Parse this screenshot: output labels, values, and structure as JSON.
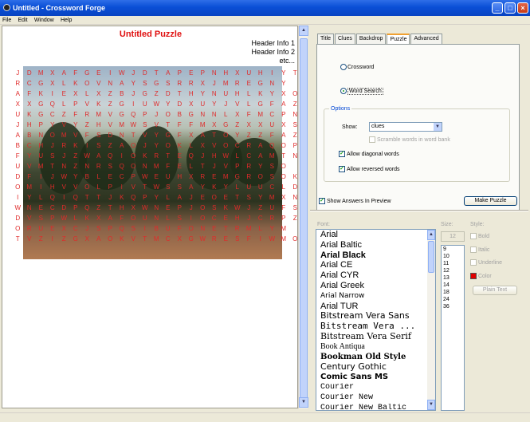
{
  "window": {
    "title": "Untitled - Crossword Forge"
  },
  "menu": [
    "File",
    "Edit",
    "Window",
    "Help"
  ],
  "puzzle": {
    "title": "Untitled Puzzle",
    "header_lines": [
      "Header Info 1",
      "Header Info 2",
      "etc..."
    ],
    "grid": [
      "JDMXAFGEIWJDTAPEPNHXUHIYT",
      "RCGXLKOVNAYSGSRRXJMREGNY",
      "AFKIEXLXZBJGZDTHYNUHLKYXO",
      "XXGQLPVKZGIUWYDXUYJVLGFAZ",
      "UKGCZFRMVGQPJOBGNNLXFMCPN",
      "JHPYVYZHVMWSVTFFMXGZXXUXS",
      "ABNOMVFSDNTVYGFXATOYZZFAZ",
      "BCHJRKISZAOJYOKLXVOCRAQOPN",
      "FYUSJZWAQIOKRTEQJHWLCAMTN",
      "UVMTNZNRSQONMFELTJVPRYSO",
      "DFIJWYBLECPWEUHXREMGROSOK",
      "OMIHVVOLPIVTWSSAYKYLUUCLD",
      "IYLQIQTTJKQPYLAJEOETSYMXN",
      "WNECDPQZTHXWNEPJOSKWJZUFS",
      "DVSPWLKXAFOUNLSIOCEHJCRPZ",
      "ORUEXCJSPQSIBUFONETRMLYM",
      "TVZIZGXAOKVTMCXGWRESFIWMO"
    ]
  },
  "tabs": [
    "Title",
    "Clues",
    "Backdrop",
    "Puzzle",
    "Advanced"
  ],
  "puzzle_tab": {
    "radio_crossword": "Crossword",
    "radio_wordsearch": "Word Search",
    "selected_type": "Word Search",
    "options_legend": "Options",
    "show_label": "Show:",
    "show_value": "clues",
    "scramble_label": "Scramble words in word bank",
    "allow_diagonal": "Allow diagonal words",
    "allow_reversed": "Allow reversed words"
  },
  "show_answers_label": "Show Answers In Preview",
  "make_puzzle_label": "Make Puzzle",
  "font_panel": {
    "font_label": "Font:",
    "size_label": "Size:",
    "style_label": "Style:",
    "size_value": "12",
    "fonts": [
      "Arial",
      "Arial Baltic",
      "Arial Black",
      "Arial CE",
      "Arial CYR",
      "Arial Greek",
      "Arial Narrow",
      "Arial TUR",
      "Bitstream Vera Sans",
      "Bitstream Vera ...",
      "Bitstream Vera Serif",
      "Book Antiqua",
      "Bookman Old Style",
      "Century Gothic",
      "Comic Sans MS",
      "Courier",
      "Courier New",
      "Courier New Baltic"
    ],
    "sizes": [
      "9",
      "10",
      "11",
      "12",
      "13",
      "14",
      "18",
      "24",
      "36"
    ],
    "bold": "Bold",
    "italic": "Italic",
    "underline": "Underline",
    "color": "Color",
    "plain_text": "Plain Text",
    "color_swatch": "#e00000"
  }
}
